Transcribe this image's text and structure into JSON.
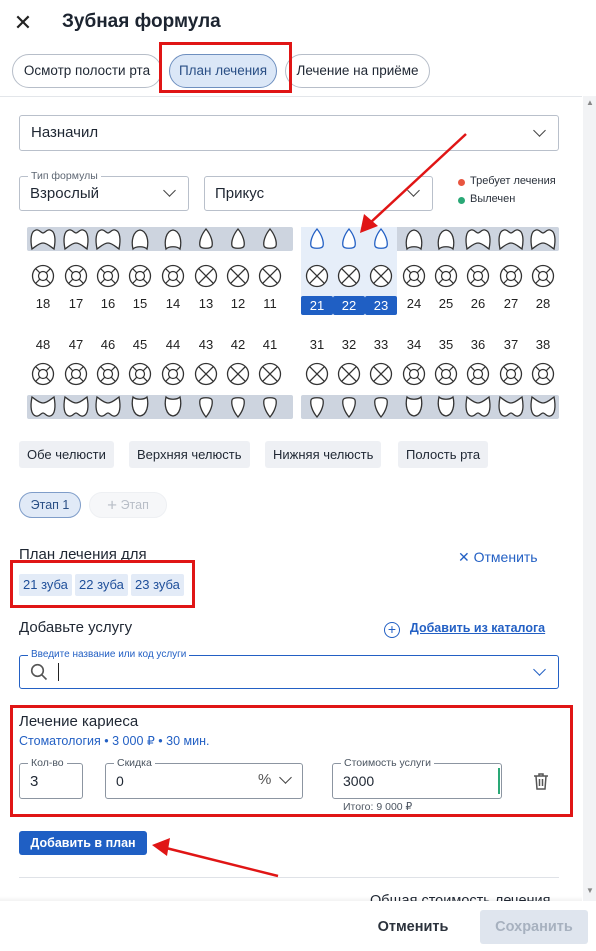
{
  "header": {
    "title": "Зубная формула",
    "close_icon": "close-icon"
  },
  "tabs": [
    {
      "label": "Осмотр полости рта",
      "active": false
    },
    {
      "label": "План лечения",
      "active": true
    },
    {
      "label": "Лечение на приёме",
      "active": false
    }
  ],
  "doctor_select": {
    "value": "Назначил"
  },
  "formula": {
    "type_label": "Тип формулы",
    "type_value": "Взрослый",
    "bite_value": "Прикус",
    "legend": [
      {
        "label": "Требует лечения",
        "color": "#e8553f"
      },
      {
        "label": "Вылечен",
        "color": "#2aa876"
      }
    ],
    "upper_teeth": [
      "18",
      "17",
      "16",
      "15",
      "14",
      "13",
      "12",
      "11",
      "21",
      "22",
      "23",
      "24",
      "25",
      "26",
      "27",
      "28"
    ],
    "lower_teeth": [
      "48",
      "47",
      "46",
      "45",
      "44",
      "43",
      "42",
      "41",
      "31",
      "32",
      "33",
      "34",
      "35",
      "36",
      "37",
      "38"
    ],
    "selected_teeth": [
      "21",
      "22",
      "23"
    ]
  },
  "jaw_buttons": [
    "Обе челюсти",
    "Верхняя челюсть",
    "Нижняя челюсть",
    "Полость рта"
  ],
  "stages": {
    "active": "Этап 1",
    "add": "Этап"
  },
  "plan": {
    "title": "План лечения для",
    "cancel": "Отменить",
    "teeth_tags": [
      "21 зуба",
      "22 зуба",
      "23 зуба"
    ]
  },
  "add_service": {
    "title": "Добавьте услугу",
    "catalog_link": "Добавить из каталога",
    "search_label": "Введите название или код услуги",
    "search_value": ""
  },
  "service": {
    "name": "Лечение кариеса",
    "details": "Стоматология • 3 000 ₽ • 30 мин.",
    "qty_label": "Кол-во",
    "qty_value": "3",
    "discount_label": "Скидка",
    "discount_value": "0",
    "discount_unit": "%",
    "cost_label": "Стоимость услуги",
    "cost_value": "3000",
    "total": "Итого: 9 000 ₽"
  },
  "add_to_plan": "Добавить в план",
  "total_cost_label": "Общая стоимость лечения",
  "footer": {
    "cancel": "Отменить",
    "save": "Сохранить"
  }
}
